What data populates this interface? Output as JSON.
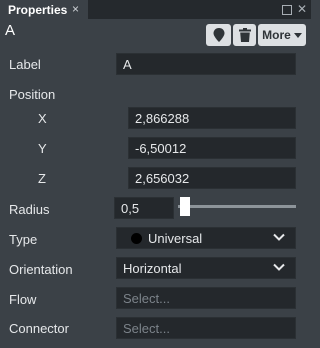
{
  "tab": {
    "title": "Properties",
    "close": "×"
  },
  "window": {
    "close": "✕"
  },
  "header": {
    "title": "A",
    "more_label": "More"
  },
  "form": {
    "label": {
      "label": "Label",
      "value": "A"
    },
    "position": {
      "label": "Position",
      "x": {
        "label": "X",
        "value": "2,866288"
      },
      "y": {
        "label": "Y",
        "value": "-6,50012"
      },
      "z": {
        "label": "Z",
        "value": "2,656032"
      }
    },
    "radius": {
      "label": "Radius",
      "value": "0,5",
      "slider_fraction": 0.02
    },
    "type": {
      "label": "Type",
      "value": "Universal"
    },
    "orientation": {
      "label": "Orientation",
      "value": "Horizontal"
    },
    "flow": {
      "label": "Flow",
      "placeholder": "Select..."
    },
    "connector": {
      "label": "Connector",
      "placeholder": "Select..."
    }
  },
  "colors": {
    "panel_bg": "#3b4147",
    "input_bg": "#24282c",
    "button_bg": "#dde0e3",
    "tabbar_bg": "#25292d"
  },
  "icons": [
    "close-icon",
    "maximize-icon",
    "marker-icon",
    "trash-icon",
    "chevron-down-icon"
  ]
}
